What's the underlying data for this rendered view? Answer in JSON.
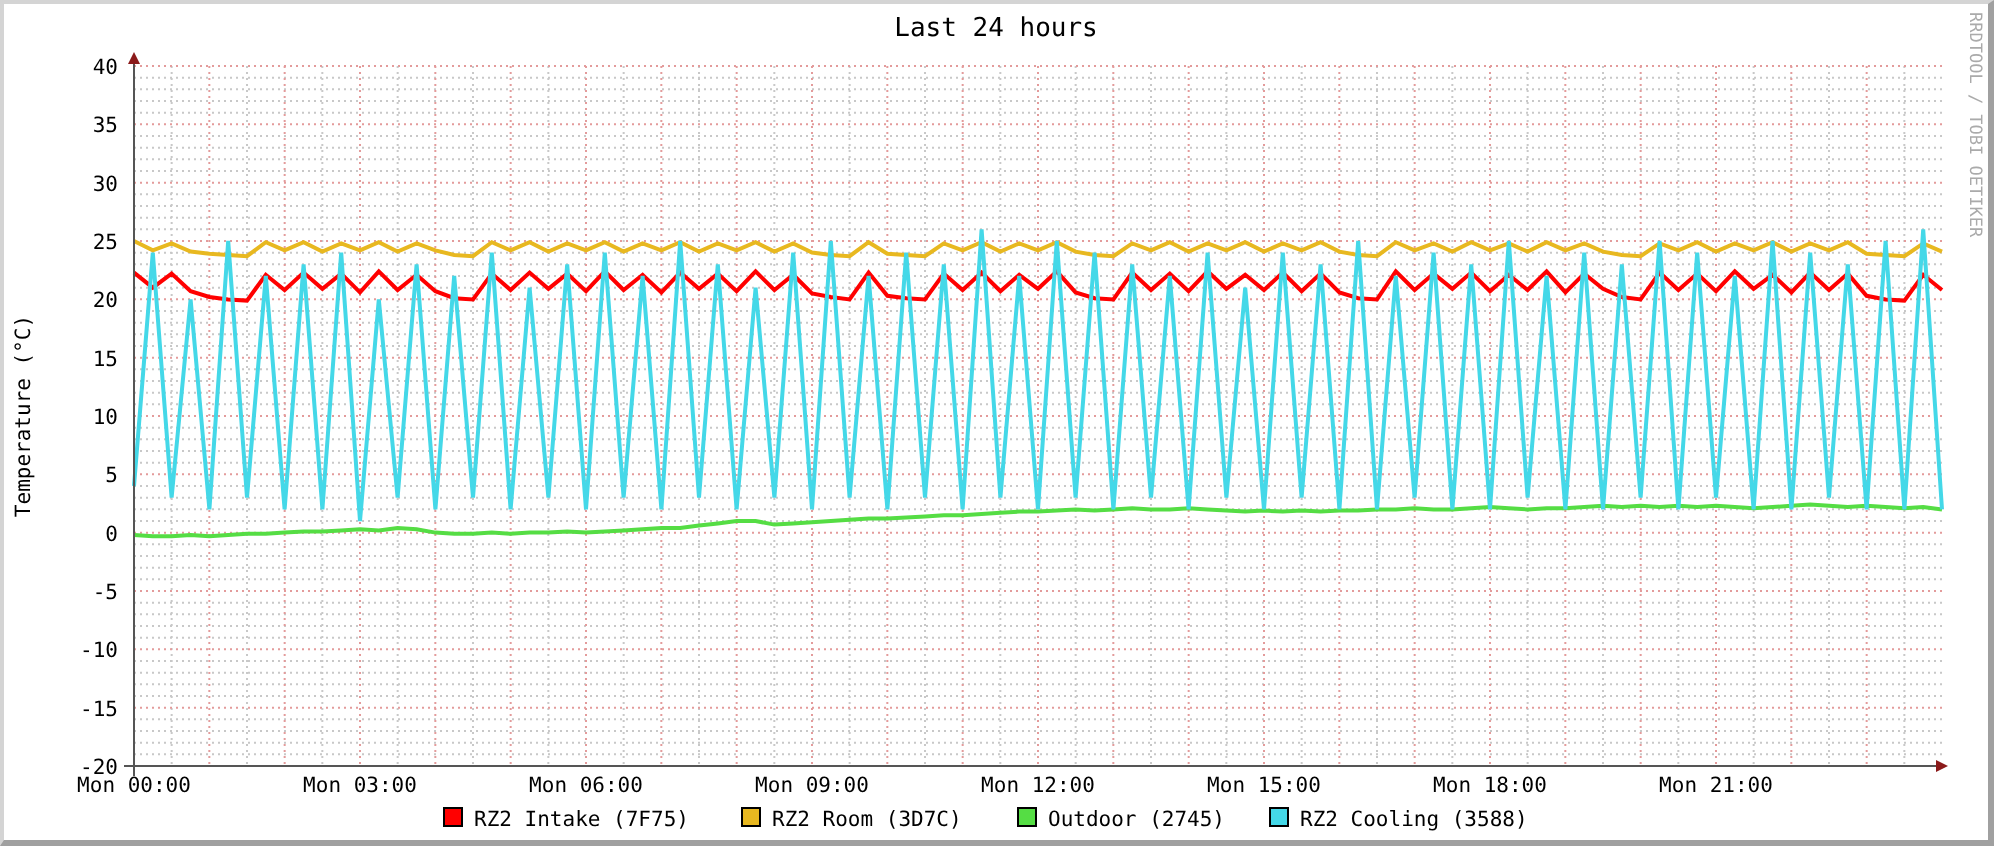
{
  "watermark": "RRDTOOL / TOBI OETIKER",
  "chart_data": {
    "type": "line",
    "title": "Last 24 hours",
    "ylabel": "Temperature (°C)",
    "ylim": [
      -20,
      40
    ],
    "grid": true,
    "legend": true,
    "categories": [
      "Mon 00:00",
      null,
      null,
      null,
      null,
      null,
      null,
      null,
      null,
      null,
      null,
      null,
      "Mon 03:00",
      null,
      null,
      null,
      null,
      null,
      null,
      null,
      null,
      null,
      null,
      null,
      "Mon 06:00",
      null,
      null,
      null,
      null,
      null,
      null,
      null,
      null,
      null,
      null,
      null,
      "Mon 09:00",
      null,
      null,
      null,
      null,
      null,
      null,
      null,
      null,
      null,
      null,
      null,
      "Mon 12:00",
      null,
      null,
      null,
      null,
      null,
      null,
      null,
      null,
      null,
      null,
      null,
      "Mon 15:00",
      null,
      null,
      null,
      null,
      null,
      null,
      null,
      null,
      null,
      null,
      null,
      "Mon 18:00",
      null,
      null,
      null,
      null,
      null,
      null,
      null,
      null,
      null,
      null,
      null,
      "Mon 21:00",
      null,
      null,
      null,
      null,
      null,
      null,
      null,
      null,
      null,
      null,
      null,
      null
    ],
    "yticks": [
      -20,
      -15,
      -10,
      -5,
      0,
      5,
      10,
      15,
      20,
      25,
      30,
      35,
      40
    ],
    "series": [
      {
        "name": "RZ2 Intake (7F75)",
        "color": "#ff0000",
        "values": [
          22.3,
          21.0,
          22.2,
          20.7,
          20.2,
          20.0,
          19.9,
          22.1,
          20.8,
          22.3,
          20.9,
          22.2,
          20.6,
          22.4,
          20.8,
          22.1,
          20.7,
          20.1,
          20.0,
          22.2,
          20.8,
          22.3,
          20.9,
          22.2,
          20.7,
          22.4,
          20.8,
          22.1,
          20.6,
          22.3,
          20.9,
          22.2,
          20.7,
          22.4,
          20.8,
          22.1,
          20.5,
          20.2,
          20.0,
          22.3,
          20.3,
          20.1,
          20.0,
          22.2,
          20.8,
          22.3,
          20.7,
          22.1,
          20.9,
          22.4,
          20.6,
          20.1,
          20.0,
          22.3,
          20.8,
          22.2,
          20.7,
          22.4,
          20.9,
          22.1,
          20.8,
          22.3,
          20.7,
          22.2,
          20.6,
          20.1,
          20.0,
          22.4,
          20.8,
          22.2,
          20.9,
          22.3,
          20.7,
          22.1,
          20.8,
          22.4,
          20.6,
          22.2,
          20.9,
          20.2,
          20.0,
          22.3,
          20.8,
          22.2,
          20.7,
          22.4,
          20.9,
          22.1,
          20.6,
          22.3,
          20.8,
          22.2,
          20.3,
          20.0,
          19.9,
          22.1,
          20.8
        ]
      },
      {
        "name": "RZ2 Room (3D7C)",
        "color": "#e8b820",
        "values": [
          25.0,
          24.2,
          24.8,
          24.1,
          23.9,
          23.8,
          23.7,
          24.9,
          24.2,
          24.9,
          24.1,
          24.8,
          24.2,
          24.9,
          24.1,
          24.8,
          24.2,
          23.8,
          23.7,
          24.9,
          24.2,
          24.9,
          24.1,
          24.8,
          24.2,
          24.9,
          24.1,
          24.8,
          24.2,
          24.9,
          24.1,
          24.8,
          24.2,
          24.9,
          24.1,
          24.8,
          24.0,
          23.8,
          23.7,
          24.9,
          23.9,
          23.8,
          23.7,
          24.8,
          24.2,
          24.9,
          24.1,
          24.8,
          24.2,
          24.9,
          24.1,
          23.8,
          23.7,
          24.8,
          24.2,
          24.9,
          24.1,
          24.8,
          24.2,
          24.9,
          24.1,
          24.8,
          24.2,
          24.9,
          24.1,
          23.8,
          23.7,
          24.9,
          24.2,
          24.8,
          24.1,
          24.9,
          24.2,
          24.8,
          24.1,
          24.9,
          24.2,
          24.8,
          24.1,
          23.8,
          23.7,
          24.8,
          24.2,
          24.9,
          24.1,
          24.8,
          24.2,
          24.9,
          24.1,
          24.8,
          24.2,
          24.9,
          23.9,
          23.8,
          23.7,
          24.8,
          24.1
        ]
      },
      {
        "name": "Outdoor (2745)",
        "color": "#55dd44",
        "values": [
          -0.2,
          -0.3,
          -0.3,
          -0.2,
          -0.3,
          -0.2,
          -0.1,
          -0.1,
          0.0,
          0.1,
          0.1,
          0.2,
          0.3,
          0.2,
          0.4,
          0.3,
          0.0,
          -0.1,
          -0.1,
          0.0,
          -0.1,
          0.0,
          0.0,
          0.1,
          0.0,
          0.1,
          0.2,
          0.3,
          0.4,
          0.4,
          0.6,
          0.8,
          1.0,
          1.0,
          0.7,
          0.8,
          0.9,
          1.0,
          1.1,
          1.2,
          1.2,
          1.3,
          1.4,
          1.5,
          1.5,
          1.6,
          1.7,
          1.8,
          1.8,
          1.9,
          2.0,
          1.9,
          2.0,
          2.1,
          2.0,
          2.0,
          2.1,
          2.0,
          1.9,
          1.8,
          1.9,
          1.8,
          1.9,
          1.8,
          1.9,
          1.9,
          2.0,
          2.0,
          2.1,
          2.0,
          2.0,
          2.1,
          2.2,
          2.1,
          2.0,
          2.1,
          2.1,
          2.2,
          2.3,
          2.2,
          2.3,
          2.2,
          2.3,
          2.2,
          2.3,
          2.2,
          2.1,
          2.2,
          2.3,
          2.4,
          2.3,
          2.2,
          2.3,
          2.2,
          2.1,
          2.2,
          2.0
        ]
      },
      {
        "name": "RZ2 Cooling (3588)",
        "color": "#44d8e8",
        "values": [
          4,
          24,
          3,
          20,
          2,
          25,
          3,
          22,
          2,
          23,
          2,
          24,
          1,
          20,
          3,
          23,
          2,
          22,
          3,
          24,
          2,
          21,
          3,
          23,
          2,
          24,
          3,
          22,
          2,
          25,
          3,
          23,
          2,
          21,
          3,
          24,
          2,
          25,
          3,
          22,
          2,
          24,
          3,
          23,
          2,
          26,
          3,
          22,
          2,
          25,
          3,
          24,
          2,
          23,
          3,
          22,
          2,
          24,
          3,
          21,
          2,
          24,
          3,
          23,
          2,
          25,
          2,
          22,
          3,
          24,
          2,
          23,
          2,
          25,
          3,
          22,
          2,
          24,
          2,
          23,
          3,
          25,
          2,
          24,
          3,
          22,
          2,
          25,
          2,
          24,
          3,
          23,
          2,
          25,
          2,
          26,
          2
        ]
      }
    ]
  }
}
